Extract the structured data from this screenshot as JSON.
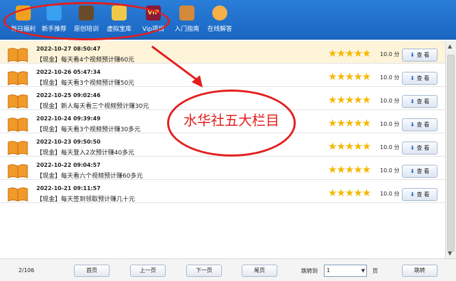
{
  "toolbar": {
    "items": [
      {
        "label": "每日福利",
        "icon": "gift-icon",
        "color": "#f0a020"
      },
      {
        "label": "新手推荐",
        "icon": "user-icon",
        "color": "#3aa0f0"
      },
      {
        "label": "原创培训",
        "icon": "blackboard-icon",
        "color": "#6a4a2a"
      },
      {
        "label": "虚拟宝库",
        "icon": "bank-icon",
        "color": "#f2c84a"
      },
      {
        "label": "Vip项目",
        "icon": "vip-icon",
        "color": "#8a1a3a"
      },
      {
        "label": "入门指南",
        "icon": "book-guide-icon",
        "color": "#d48a3a"
      },
      {
        "label": "在线解答",
        "icon": "support-icon",
        "color": "#f6b048"
      }
    ]
  },
  "annotation": {
    "text": "水华社五大栏目",
    "color": "#e41e1e"
  },
  "list": {
    "items": [
      {
        "date": "2022-10-27 08:50:47",
        "title": "【现金】每天看4个视频预计赚60元",
        "stars": "★★★★★",
        "score": "10.0 分",
        "button": "查 看",
        "selected": true
      },
      {
        "date": "2022-10-26 05:47:34",
        "title": "【现金】每天看3个视频预计赚50元",
        "stars": "★★★★★",
        "score": "10.0 分",
        "button": "查 看",
        "selected": false
      },
      {
        "date": "2022-10-25 09:02:46",
        "title": "【现金】新人每天看三个视频预计赚30元",
        "stars": "★★★★★",
        "score": "10.0 分",
        "button": "查 看",
        "selected": false
      },
      {
        "date": "2022-10-24 09:39:49",
        "title": "【现金】每天看3个视频预计赚30多元",
        "stars": "★★★★★",
        "score": "10.0 分",
        "button": "查 看",
        "selected": false
      },
      {
        "date": "2022-10-23 09:50:50",
        "title": "【现金】每天登入2次预计赚40多元",
        "stars": "★★★★★",
        "score": "10.0 分",
        "button": "查 看",
        "selected": false
      },
      {
        "date": "2022-10-22 09:04:57",
        "title": "【现金】每天看六个视频预计赚60多元",
        "stars": "★★★★★",
        "score": "10.0 分",
        "button": "查 看",
        "selected": false
      },
      {
        "date": "2022-10-21 09:11:57",
        "title": "【现金】每天签到领取预计赚几十元",
        "stars": "★★★★★",
        "score": "10.0 分",
        "button": "查 看",
        "selected": false
      }
    ],
    "rating_color": "#f5b800"
  },
  "footer": {
    "page_info": "2/106",
    "first": "首页",
    "prev": "上一页",
    "next": "下一页",
    "last": "尾页",
    "jump_label": "跳转到",
    "jump_value": "1",
    "page_unit": "页",
    "jump_button": "跳转"
  },
  "colors": {
    "toolbar": "#2a7ed8",
    "selected_row": "#fdf4d9"
  }
}
